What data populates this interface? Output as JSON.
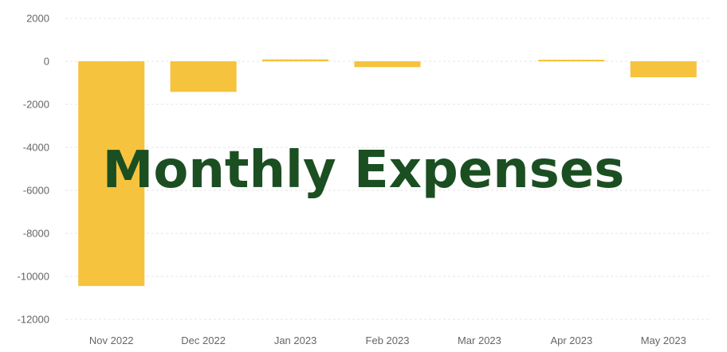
{
  "chart_data": {
    "type": "bar",
    "title": "Monthly Expenses",
    "categories": [
      "Nov 2022",
      "Dec 2022",
      "Jan 2023",
      "Feb 2023",
      "Mar 2023",
      "Apr 2023",
      "May 2023"
    ],
    "values": [
      -10450,
      -1420,
      90,
      -270,
      0,
      40,
      -740
    ],
    "ylim": [
      -12000,
      2000
    ],
    "yticks": [
      2000,
      0,
      -2000,
      -4000,
      -6000,
      -8000,
      -10000,
      -12000
    ],
    "grid": true,
    "colors": {
      "bar": "#F5C33E",
      "title": "#1B4F22",
      "grid": "#e6e6e6",
      "tick_text": "#666666"
    }
  }
}
